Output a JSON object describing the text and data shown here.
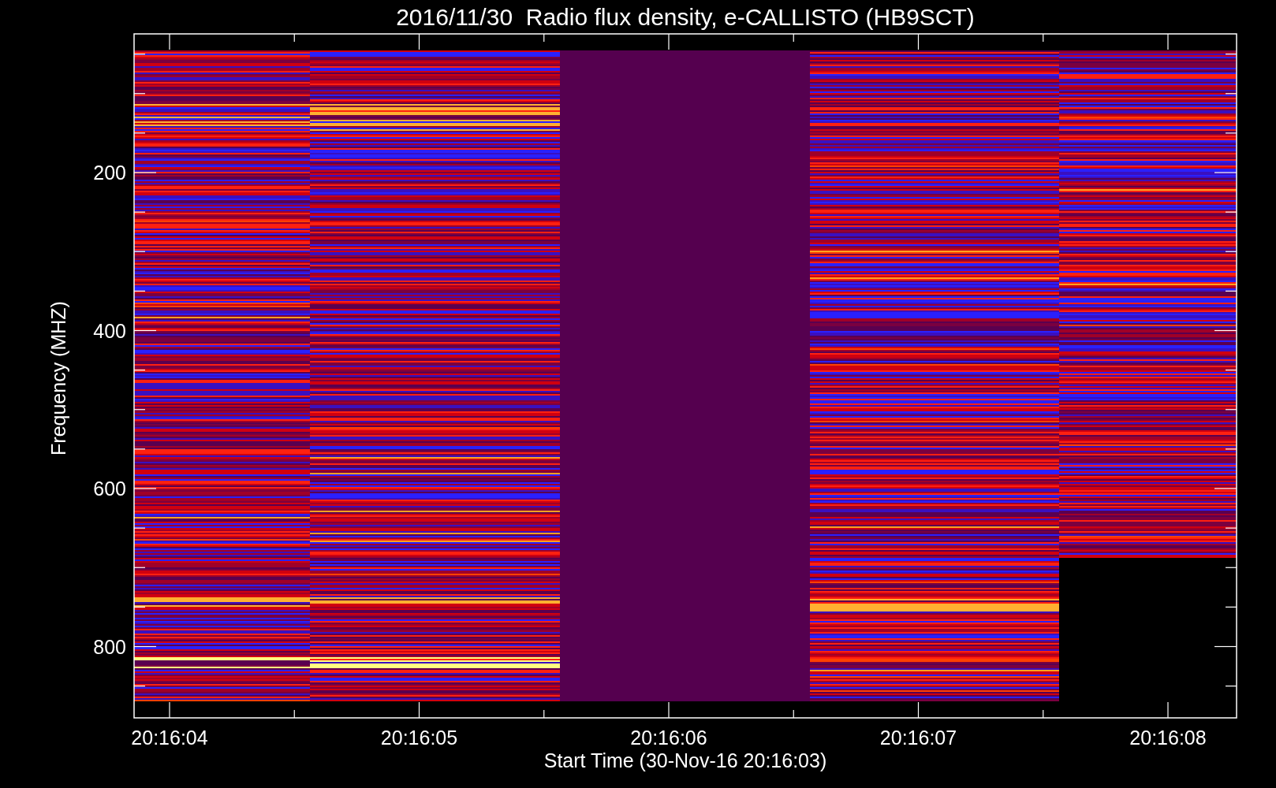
{
  "plot": {
    "title": "2016/11/30  Radio flux density, e-CALLISTO (HB9SCT)",
    "xlabel": "Start Time (30-Nov-16 20:16:03)",
    "ylabel": "Frequency (MHZ)",
    "x_tick_labels": [
      "20:16:04",
      "20:16:05",
      "20:16:06",
      "20:16:07",
      "20:16:08"
    ],
    "y_tick_labels": [
      "200",
      "400",
      "600",
      "800"
    ]
  }
}
